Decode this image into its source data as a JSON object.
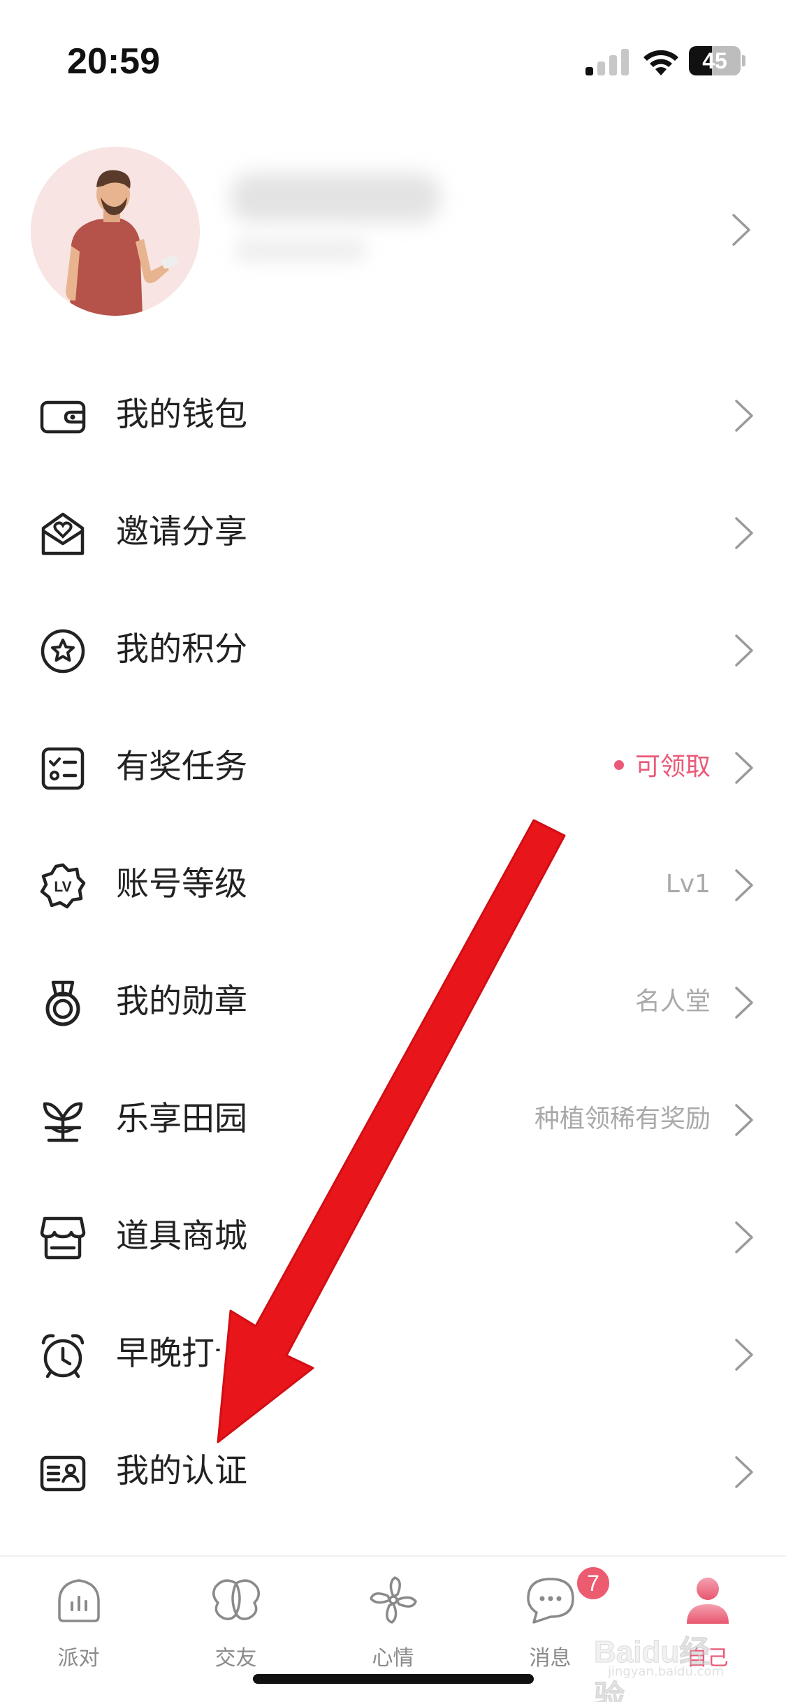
{
  "status_bar": {
    "time": "20:59",
    "battery": "45",
    "battery_level": 0.45
  },
  "profile": {
    "nickname": "",
    "subtitle": ""
  },
  "menu": {
    "items": [
      {
        "label": "我的钱包",
        "value": "",
        "icon": "wallet-icon"
      },
      {
        "label": "邀请分享",
        "value": "",
        "icon": "invite-envelope-icon"
      },
      {
        "label": "我的积分",
        "value": "",
        "icon": "star-circle-icon"
      },
      {
        "label": "有奖任务",
        "value": "可领取",
        "icon": "task-checklist-icon"
      },
      {
        "label": "账号等级",
        "value": "Lv1",
        "icon": "level-badge-icon"
      },
      {
        "label": "我的勋章",
        "value": "名人堂",
        "icon": "medal-icon"
      },
      {
        "label": "乐享田园",
        "value": "种植领稀有奖励",
        "icon": "sprout-icon"
      },
      {
        "label": "道具商城",
        "value": "",
        "icon": "store-icon"
      },
      {
        "label": "早晚打卡",
        "value": "",
        "icon": "alarm-clock-icon"
      },
      {
        "label": "我的认证",
        "value": "",
        "icon": "id-card-icon"
      }
    ]
  },
  "tabbar": {
    "tabs": [
      {
        "label": "派对",
        "icon": "party-chart-icon"
      },
      {
        "label": "交友",
        "icon": "friends-icon"
      },
      {
        "label": "心情",
        "icon": "pinwheel-icon"
      },
      {
        "label": "消息",
        "icon": "message-bubble-icon",
        "badge": "7"
      },
      {
        "label": "自己",
        "icon": "profile-person-icon"
      }
    ],
    "active_index": 4
  },
  "colors": {
    "accent": "#ea5a78",
    "badge": "#ec5b6f",
    "annotation_arrow": "#e8151b"
  },
  "watermark": {
    "brand": "Baidu经验",
    "url": "jingyan.baidu.com"
  }
}
